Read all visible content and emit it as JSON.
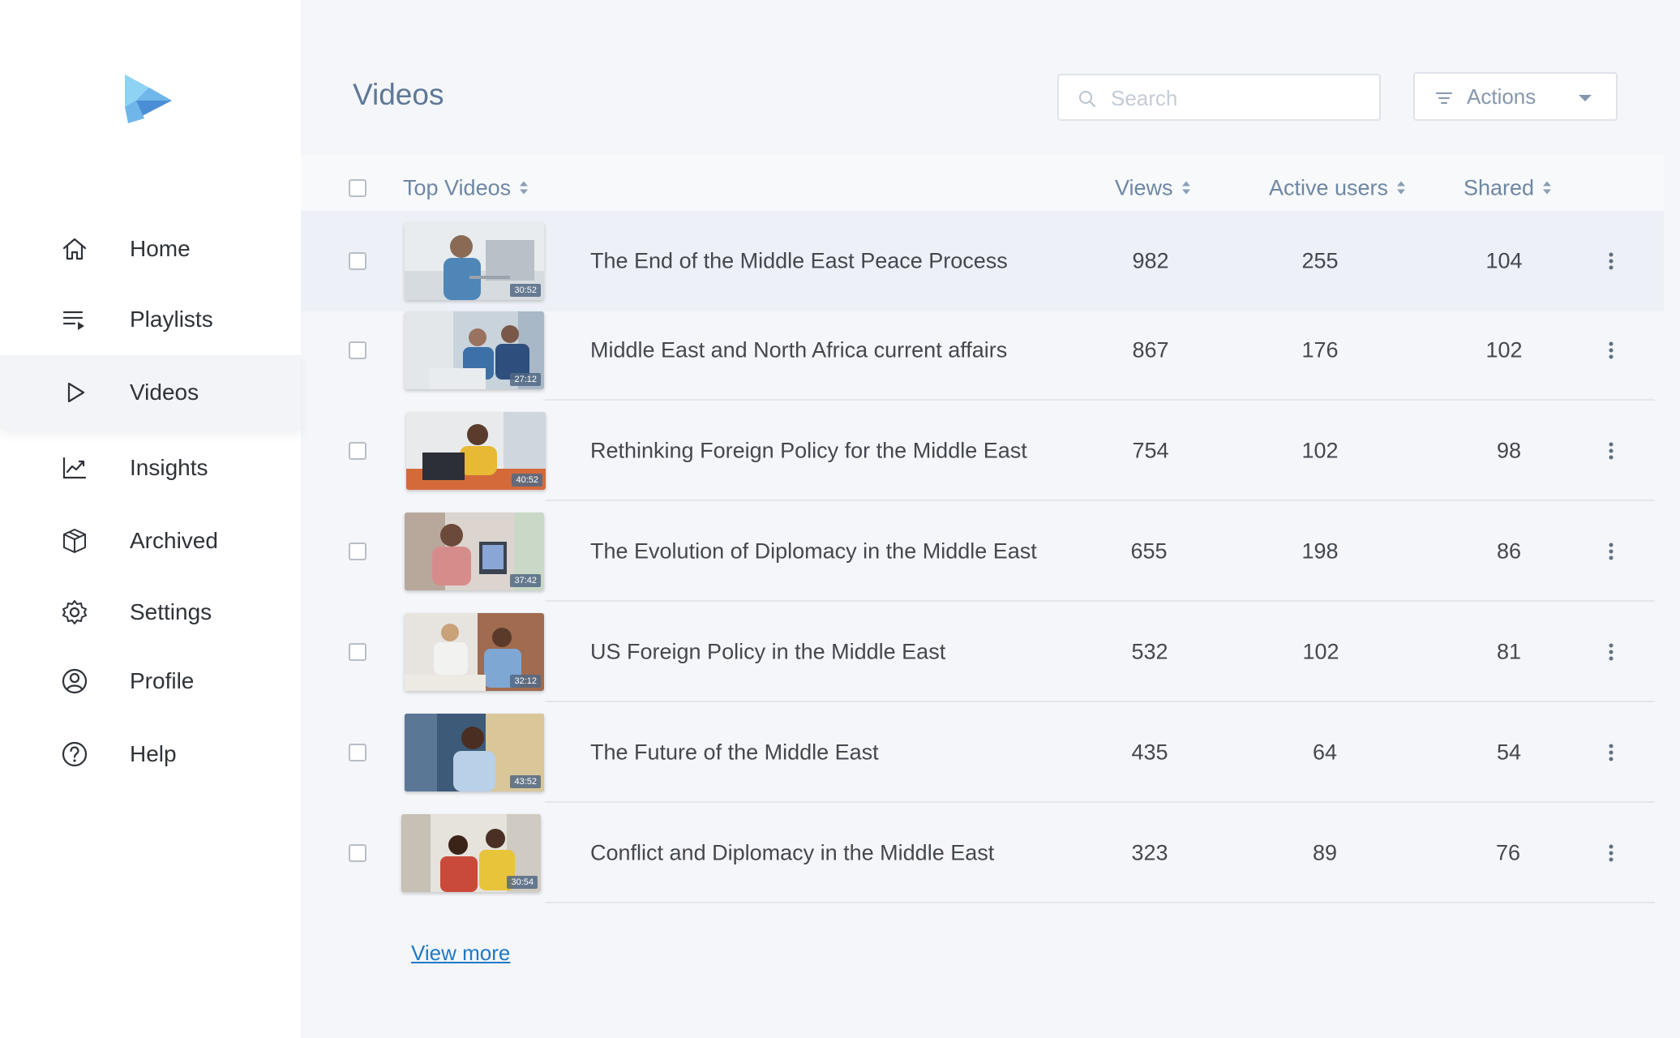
{
  "sidebar": {
    "logo": "play-logo",
    "items": [
      {
        "label": "Home",
        "icon": "home-icon"
      },
      {
        "label": "Playlists",
        "icon": "playlist-icon"
      },
      {
        "label": "Videos",
        "icon": "play-icon",
        "active": true
      },
      {
        "label": "Insights",
        "icon": "chart-line-icon"
      },
      {
        "label": "Archived",
        "icon": "box-icon"
      },
      {
        "label": "Settings",
        "icon": "gear-icon"
      },
      {
        "label": "Profile",
        "icon": "user-circle-icon"
      },
      {
        "label": "Help",
        "icon": "question-circle-icon"
      }
    ]
  },
  "header": {
    "title": "Videos",
    "search_placeholder": "Search",
    "search_value": "",
    "actions_label": "Actions"
  },
  "table": {
    "columns": {
      "video": "Top Videos",
      "views": "Views",
      "active_users": "Active users",
      "shared": "Shared"
    },
    "rows": [
      {
        "title": "The End of the Middle East Peace Process",
        "duration": "30:52",
        "views": "982",
        "active_users": "255",
        "shared": "104"
      },
      {
        "title": "Middle East and North Africa current affairs",
        "duration": "27:12",
        "views": "867",
        "active_users": "176",
        "shared": "102"
      },
      {
        "title": "Rethinking Foreign Policy for the Middle East",
        "duration": "40:52",
        "views": "754",
        "active_users": "102",
        "shared": "98"
      },
      {
        "title": "The Evolution of Diplomacy in the Middle East",
        "duration": "37:42",
        "views": "655",
        "active_users": "198",
        "shared": "86"
      },
      {
        "title": "US Foreign Policy in the Middle East",
        "duration": "32:12",
        "views": "532",
        "active_users": "102",
        "shared": "81"
      },
      {
        "title": "The Future of the Middle East",
        "duration": "43:52",
        "views": "435",
        "active_users": "64",
        "shared": "54"
      },
      {
        "title": "Conflict and Diplomacy in the Middle East",
        "duration": "30:54",
        "views": "323",
        "active_users": "89",
        "shared": "76"
      }
    ]
  },
  "footer": {
    "view_more": "View more"
  },
  "colors": {
    "accent": "#5f7896",
    "link": "#1f79c4",
    "logo_light": "#8fd3f4",
    "logo_dark": "#4a8fd6"
  }
}
